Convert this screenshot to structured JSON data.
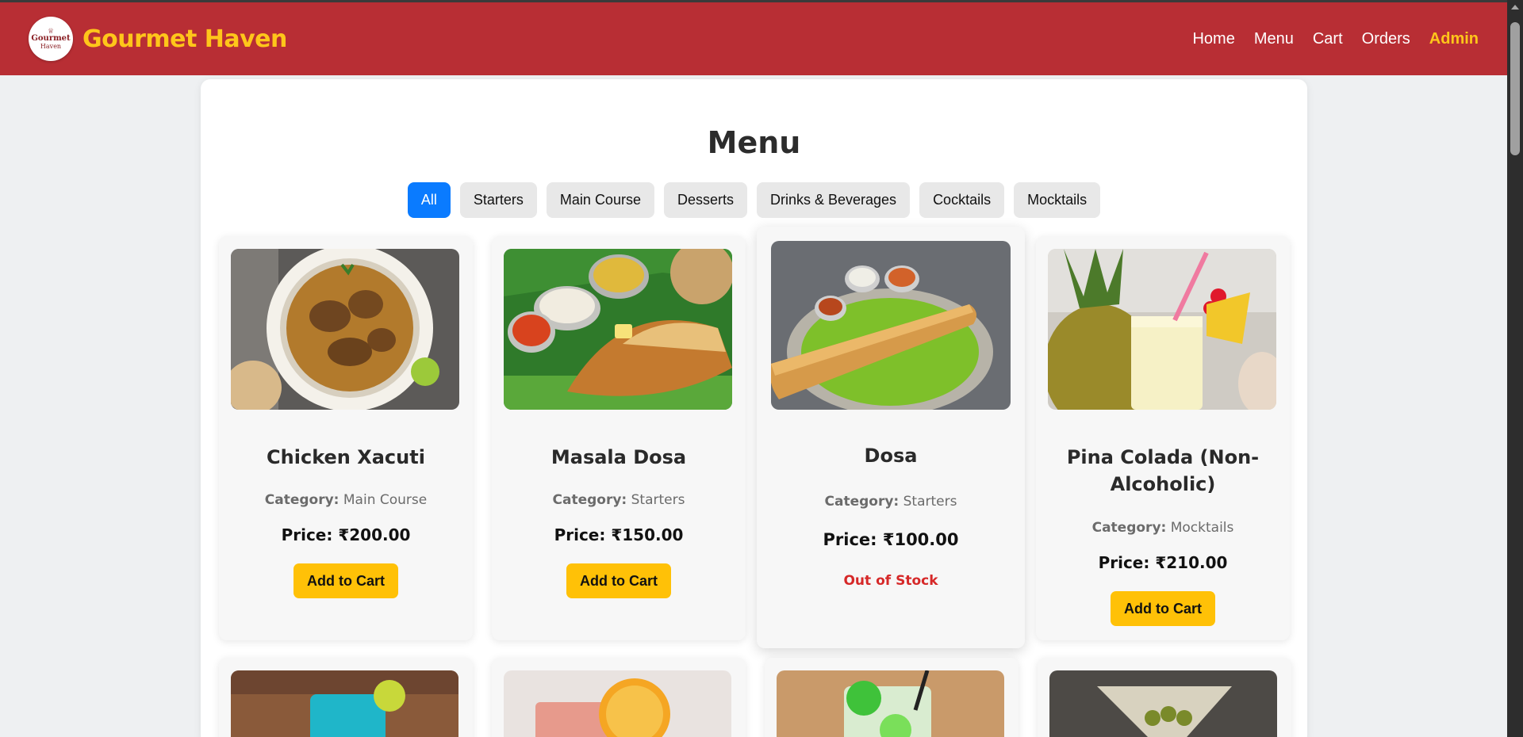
{
  "header": {
    "logo_line1": "Gourmet",
    "logo_line2": "Haven",
    "brand": "Gourmet Haven",
    "nav": [
      "Home",
      "Menu",
      "Cart",
      "Orders",
      "Admin"
    ]
  },
  "page": {
    "title": "Menu",
    "filters": [
      "All",
      "Starters",
      "Main Course",
      "Desserts",
      "Drinks & Beverages",
      "Cocktails",
      "Mocktails"
    ],
    "active_filter": "All"
  },
  "labels": {
    "category_prefix": "Category:",
    "add_to_cart": "Add to Cart",
    "out_of_stock": "Out of Stock"
  },
  "items": [
    {
      "name": "Chicken Xacuti",
      "category": "Main Course",
      "price": "Price: ₹200.00",
      "in_stock": true
    },
    {
      "name": "Masala Dosa",
      "category": "Starters",
      "price": "Price: ₹150.00",
      "in_stock": true
    },
    {
      "name": "Dosa",
      "category": "Starters",
      "price": "Price: ₹100.00",
      "in_stock": false
    },
    {
      "name": "Pina Colada (Non-Alcoholic)",
      "category": "Mocktails",
      "price": "Price: ₹210.00",
      "in_stock": true
    }
  ],
  "colors": {
    "header_bg": "#b82e34",
    "brand": "#ffc61a",
    "active_filter": "#0a7bff",
    "button": "#ffc107",
    "out_of_stock": "#d62828"
  }
}
